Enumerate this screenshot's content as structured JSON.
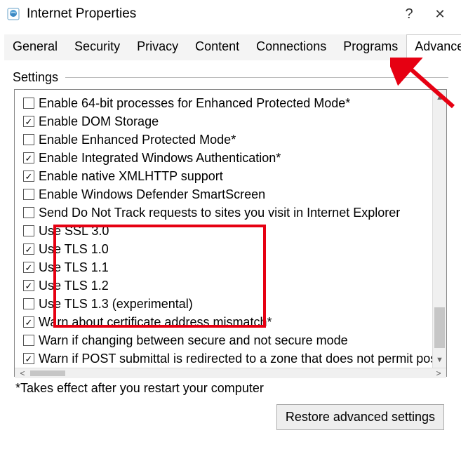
{
  "window": {
    "title": "Internet Properties",
    "help_symbol": "?",
    "close_symbol": "✕"
  },
  "tabs": [
    {
      "label": "General",
      "active": false
    },
    {
      "label": "Security",
      "active": false
    },
    {
      "label": "Privacy",
      "active": false
    },
    {
      "label": "Content",
      "active": false
    },
    {
      "label": "Connections",
      "active": false
    },
    {
      "label": "Programs",
      "active": false
    },
    {
      "label": "Advanced",
      "active": true
    }
  ],
  "settings": {
    "group_label": "Settings",
    "items": [
      {
        "label": "Enable 64-bit processes for Enhanced Protected Mode*",
        "checked": false
      },
      {
        "label": "Enable DOM Storage",
        "checked": true
      },
      {
        "label": "Enable Enhanced Protected Mode*",
        "checked": false
      },
      {
        "label": "Enable Integrated Windows Authentication*",
        "checked": true
      },
      {
        "label": "Enable native XMLHTTP support",
        "checked": true
      },
      {
        "label": "Enable Windows Defender SmartScreen",
        "checked": false
      },
      {
        "label": "Send Do Not Track requests to sites you visit in Internet Explorer",
        "checked": false
      },
      {
        "label": "Use SSL 3.0",
        "checked": false
      },
      {
        "label": "Use TLS 1.0",
        "checked": true
      },
      {
        "label": "Use TLS 1.1",
        "checked": true
      },
      {
        "label": "Use TLS 1.2",
        "checked": true
      },
      {
        "label": "Use TLS 1.3 (experimental)",
        "checked": false
      },
      {
        "label": "Warn about certificate address mismatch*",
        "checked": true
      },
      {
        "label": "Warn if changing between secure and not secure mode",
        "checked": false
      },
      {
        "label": "Warn if POST submittal is redirected to a zone that does not permit posts",
        "checked": true
      }
    ],
    "note": "*Takes effect after you restart your computer",
    "restore_label": "Restore advanced settings"
  },
  "annotation": {
    "arrow_color": "#e60012"
  }
}
